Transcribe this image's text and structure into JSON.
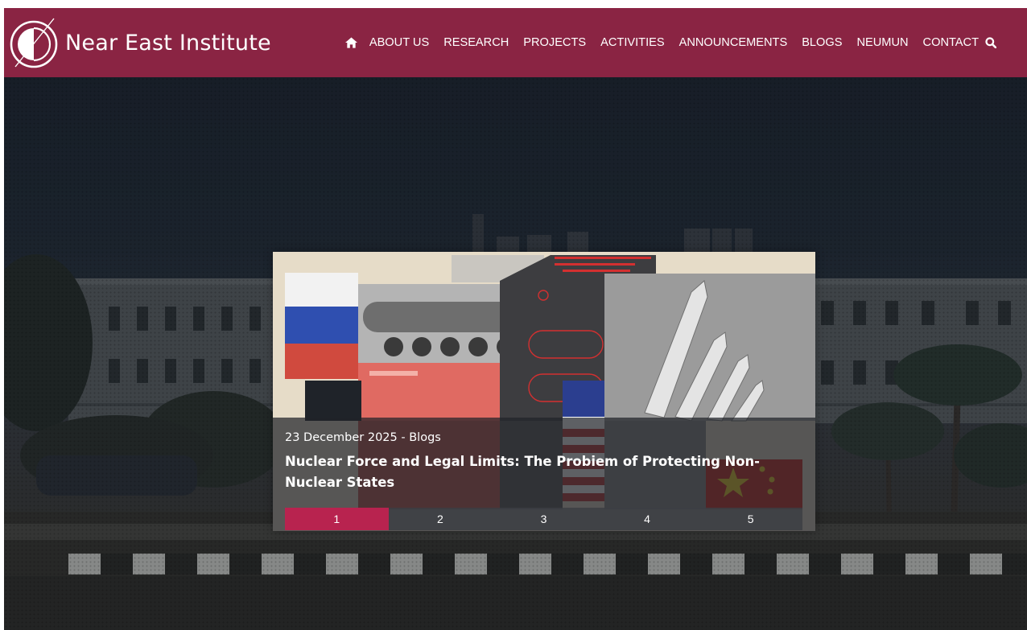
{
  "site": {
    "logo_text": "Near East Institute"
  },
  "nav": {
    "items": [
      {
        "label": "ABOUT US"
      },
      {
        "label": "RESEARCH"
      },
      {
        "label": "PROJECTS"
      },
      {
        "label": "ACTIVITIES"
      },
      {
        "label": "ANNOUNCEMENTS"
      },
      {
        "label": "BLOGS"
      },
      {
        "label": "NEUMUN"
      },
      {
        "label": "CONTACT"
      }
    ],
    "icons": [
      "home-icon",
      "search-icon"
    ]
  },
  "slider": {
    "active_index": 1,
    "slides": [
      {
        "date": "23 December 2025",
        "separator": " - ",
        "category": "Blogs",
        "title": "Nuclear Force and Legal Limits: The Probiem of Protecting Non-Nuclear States"
      }
    ],
    "pager": [
      "1",
      "2",
      "3",
      "4",
      "5"
    ]
  },
  "colors": {
    "header_bg": "#8a2443",
    "pager_active": "#b8234f",
    "caption_bg": "#202228"
  }
}
